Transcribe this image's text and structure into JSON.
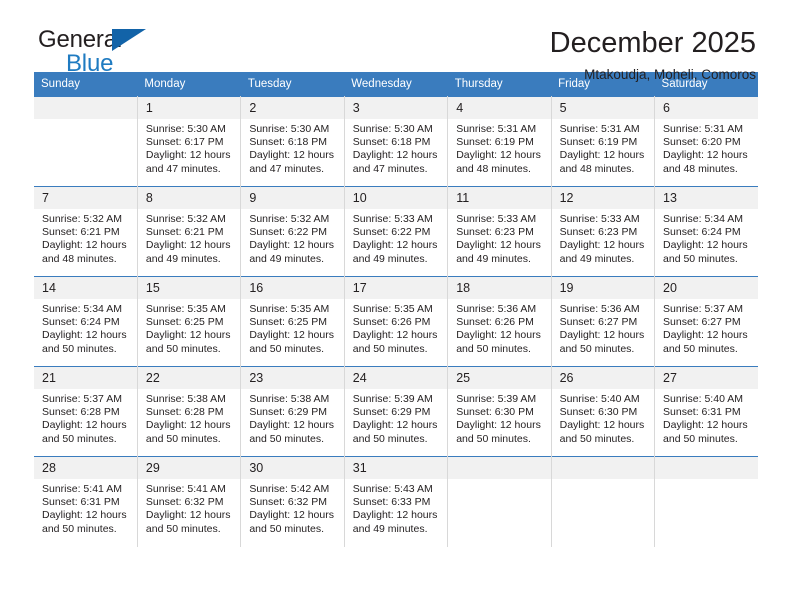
{
  "brand": {
    "name_top": "General",
    "name_bottom": "Blue",
    "accent_color": "#1263a8",
    "text_color": "#231f20"
  },
  "header": {
    "title": "December 2025",
    "subtitle": "Mtakoudja, Moheli, Comoros"
  },
  "calendar": {
    "header_color": "#3a7cbe",
    "daynum_bg": "#f1f1f1",
    "weekdays": [
      "Sunday",
      "Monday",
      "Tuesday",
      "Wednesday",
      "Thursday",
      "Friday",
      "Saturday"
    ],
    "weeks": [
      [
        {
          "day": "",
          "sunrise": "",
          "sunset": "",
          "daylight": "",
          "daylight2": ""
        },
        {
          "day": "1",
          "sunrise": "Sunrise: 5:30 AM",
          "sunset": "Sunset: 6:17 PM",
          "daylight": "Daylight: 12 hours",
          "daylight2": "and 47 minutes."
        },
        {
          "day": "2",
          "sunrise": "Sunrise: 5:30 AM",
          "sunset": "Sunset: 6:18 PM",
          "daylight": "Daylight: 12 hours",
          "daylight2": "and 47 minutes."
        },
        {
          "day": "3",
          "sunrise": "Sunrise: 5:30 AM",
          "sunset": "Sunset: 6:18 PM",
          "daylight": "Daylight: 12 hours",
          "daylight2": "and 47 minutes."
        },
        {
          "day": "4",
          "sunrise": "Sunrise: 5:31 AM",
          "sunset": "Sunset: 6:19 PM",
          "daylight": "Daylight: 12 hours",
          "daylight2": "and 48 minutes."
        },
        {
          "day": "5",
          "sunrise": "Sunrise: 5:31 AM",
          "sunset": "Sunset: 6:19 PM",
          "daylight": "Daylight: 12 hours",
          "daylight2": "and 48 minutes."
        },
        {
          "day": "6",
          "sunrise": "Sunrise: 5:31 AM",
          "sunset": "Sunset: 6:20 PM",
          "daylight": "Daylight: 12 hours",
          "daylight2": "and 48 minutes."
        }
      ],
      [
        {
          "day": "7",
          "sunrise": "Sunrise: 5:32 AM",
          "sunset": "Sunset: 6:21 PM",
          "daylight": "Daylight: 12 hours",
          "daylight2": "and 48 minutes."
        },
        {
          "day": "8",
          "sunrise": "Sunrise: 5:32 AM",
          "sunset": "Sunset: 6:21 PM",
          "daylight": "Daylight: 12 hours",
          "daylight2": "and 49 minutes."
        },
        {
          "day": "9",
          "sunrise": "Sunrise: 5:32 AM",
          "sunset": "Sunset: 6:22 PM",
          "daylight": "Daylight: 12 hours",
          "daylight2": "and 49 minutes."
        },
        {
          "day": "10",
          "sunrise": "Sunrise: 5:33 AM",
          "sunset": "Sunset: 6:22 PM",
          "daylight": "Daylight: 12 hours",
          "daylight2": "and 49 minutes."
        },
        {
          "day": "11",
          "sunrise": "Sunrise: 5:33 AM",
          "sunset": "Sunset: 6:23 PM",
          "daylight": "Daylight: 12 hours",
          "daylight2": "and 49 minutes."
        },
        {
          "day": "12",
          "sunrise": "Sunrise: 5:33 AM",
          "sunset": "Sunset: 6:23 PM",
          "daylight": "Daylight: 12 hours",
          "daylight2": "and 49 minutes."
        },
        {
          "day": "13",
          "sunrise": "Sunrise: 5:34 AM",
          "sunset": "Sunset: 6:24 PM",
          "daylight": "Daylight: 12 hours",
          "daylight2": "and 50 minutes."
        }
      ],
      [
        {
          "day": "14",
          "sunrise": "Sunrise: 5:34 AM",
          "sunset": "Sunset: 6:24 PM",
          "daylight": "Daylight: 12 hours",
          "daylight2": "and 50 minutes."
        },
        {
          "day": "15",
          "sunrise": "Sunrise: 5:35 AM",
          "sunset": "Sunset: 6:25 PM",
          "daylight": "Daylight: 12 hours",
          "daylight2": "and 50 minutes."
        },
        {
          "day": "16",
          "sunrise": "Sunrise: 5:35 AM",
          "sunset": "Sunset: 6:25 PM",
          "daylight": "Daylight: 12 hours",
          "daylight2": "and 50 minutes."
        },
        {
          "day": "17",
          "sunrise": "Sunrise: 5:35 AM",
          "sunset": "Sunset: 6:26 PM",
          "daylight": "Daylight: 12 hours",
          "daylight2": "and 50 minutes."
        },
        {
          "day": "18",
          "sunrise": "Sunrise: 5:36 AM",
          "sunset": "Sunset: 6:26 PM",
          "daylight": "Daylight: 12 hours",
          "daylight2": "and 50 minutes."
        },
        {
          "day": "19",
          "sunrise": "Sunrise: 5:36 AM",
          "sunset": "Sunset: 6:27 PM",
          "daylight": "Daylight: 12 hours",
          "daylight2": "and 50 minutes."
        },
        {
          "day": "20",
          "sunrise": "Sunrise: 5:37 AM",
          "sunset": "Sunset: 6:27 PM",
          "daylight": "Daylight: 12 hours",
          "daylight2": "and 50 minutes."
        }
      ],
      [
        {
          "day": "21",
          "sunrise": "Sunrise: 5:37 AM",
          "sunset": "Sunset: 6:28 PM",
          "daylight": "Daylight: 12 hours",
          "daylight2": "and 50 minutes."
        },
        {
          "day": "22",
          "sunrise": "Sunrise: 5:38 AM",
          "sunset": "Sunset: 6:28 PM",
          "daylight": "Daylight: 12 hours",
          "daylight2": "and 50 minutes."
        },
        {
          "day": "23",
          "sunrise": "Sunrise: 5:38 AM",
          "sunset": "Sunset: 6:29 PM",
          "daylight": "Daylight: 12 hours",
          "daylight2": "and 50 minutes."
        },
        {
          "day": "24",
          "sunrise": "Sunrise: 5:39 AM",
          "sunset": "Sunset: 6:29 PM",
          "daylight": "Daylight: 12 hours",
          "daylight2": "and 50 minutes."
        },
        {
          "day": "25",
          "sunrise": "Sunrise: 5:39 AM",
          "sunset": "Sunset: 6:30 PM",
          "daylight": "Daylight: 12 hours",
          "daylight2": "and 50 minutes."
        },
        {
          "day": "26",
          "sunrise": "Sunrise: 5:40 AM",
          "sunset": "Sunset: 6:30 PM",
          "daylight": "Daylight: 12 hours",
          "daylight2": "and 50 minutes."
        },
        {
          "day": "27",
          "sunrise": "Sunrise: 5:40 AM",
          "sunset": "Sunset: 6:31 PM",
          "daylight": "Daylight: 12 hours",
          "daylight2": "and 50 minutes."
        }
      ],
      [
        {
          "day": "28",
          "sunrise": "Sunrise: 5:41 AM",
          "sunset": "Sunset: 6:31 PM",
          "daylight": "Daylight: 12 hours",
          "daylight2": "and 50 minutes."
        },
        {
          "day": "29",
          "sunrise": "Sunrise: 5:41 AM",
          "sunset": "Sunset: 6:32 PM",
          "daylight": "Daylight: 12 hours",
          "daylight2": "and 50 minutes."
        },
        {
          "day": "30",
          "sunrise": "Sunrise: 5:42 AM",
          "sunset": "Sunset: 6:32 PM",
          "daylight": "Daylight: 12 hours",
          "daylight2": "and 50 minutes."
        },
        {
          "day": "31",
          "sunrise": "Sunrise: 5:43 AM",
          "sunset": "Sunset: 6:33 PM",
          "daylight": "Daylight: 12 hours",
          "daylight2": "and 49 minutes."
        },
        {
          "day": "",
          "sunrise": "",
          "sunset": "",
          "daylight": "",
          "daylight2": ""
        },
        {
          "day": "",
          "sunrise": "",
          "sunset": "",
          "daylight": "",
          "daylight2": ""
        },
        {
          "day": "",
          "sunrise": "",
          "sunset": "",
          "daylight": "",
          "daylight2": ""
        }
      ]
    ]
  }
}
